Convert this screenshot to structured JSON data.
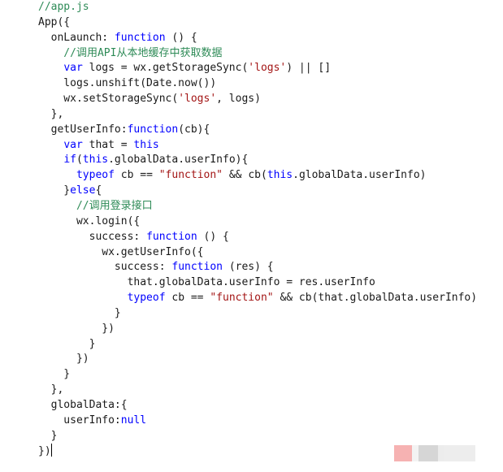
{
  "editor": {
    "lines": [
      [
        {
          "t": "//app.js",
          "c": "comment"
        }
      ],
      [
        {
          "t": "App({",
          "c": "plain"
        }
      ],
      [
        {
          "t": "  onLaunch: ",
          "c": "plain"
        },
        {
          "t": "function",
          "c": "keyword"
        },
        {
          "t": " () {",
          "c": "plain"
        }
      ],
      [
        {
          "t": "    //调用API从本地缓存中获取数据",
          "c": "comment"
        }
      ],
      [
        {
          "t": "    ",
          "c": "plain"
        },
        {
          "t": "var",
          "c": "keyword"
        },
        {
          "t": " logs = wx.getStorageSync(",
          "c": "plain"
        },
        {
          "t": "'logs'",
          "c": "string"
        },
        {
          "t": ") || []",
          "c": "plain"
        }
      ],
      [
        {
          "t": "    logs.unshift(Date.now())",
          "c": "plain"
        }
      ],
      [
        {
          "t": "    wx.setStorageSync(",
          "c": "plain"
        },
        {
          "t": "'logs'",
          "c": "string"
        },
        {
          "t": ", logs)",
          "c": "plain"
        }
      ],
      [
        {
          "t": "  },",
          "c": "plain"
        }
      ],
      [
        {
          "t": "  getUserInfo:",
          "c": "plain"
        },
        {
          "t": "function",
          "c": "keyword"
        },
        {
          "t": "(cb){",
          "c": "plain"
        }
      ],
      [
        {
          "t": "    ",
          "c": "plain"
        },
        {
          "t": "var",
          "c": "keyword"
        },
        {
          "t": " that = ",
          "c": "plain"
        },
        {
          "t": "this",
          "c": "keyword"
        }
      ],
      [
        {
          "t": "    ",
          "c": "plain"
        },
        {
          "t": "if",
          "c": "keyword"
        },
        {
          "t": "(",
          "c": "plain"
        },
        {
          "t": "this",
          "c": "keyword"
        },
        {
          "t": ".globalData.userInfo){",
          "c": "plain"
        }
      ],
      [
        {
          "t": "      ",
          "c": "plain"
        },
        {
          "t": "typeof",
          "c": "keyword"
        },
        {
          "t": " cb == ",
          "c": "plain"
        },
        {
          "t": "\"function\"",
          "c": "string"
        },
        {
          "t": " && cb(",
          "c": "plain"
        },
        {
          "t": "this",
          "c": "keyword"
        },
        {
          "t": ".globalData.userInfo)",
          "c": "plain"
        }
      ],
      [
        {
          "t": "    }",
          "c": "plain"
        },
        {
          "t": "else",
          "c": "keyword"
        },
        {
          "t": "{",
          "c": "plain"
        }
      ],
      [
        {
          "t": "      //调用登录接口",
          "c": "comment"
        }
      ],
      [
        {
          "t": "      wx.login({",
          "c": "plain"
        }
      ],
      [
        {
          "t": "        success: ",
          "c": "plain"
        },
        {
          "t": "function",
          "c": "keyword"
        },
        {
          "t": " () {",
          "c": "plain"
        }
      ],
      [
        {
          "t": "          wx.getUserInfo({",
          "c": "plain"
        }
      ],
      [
        {
          "t": "            success: ",
          "c": "plain"
        },
        {
          "t": "function",
          "c": "keyword"
        },
        {
          "t": " (res) {",
          "c": "plain"
        }
      ],
      [
        {
          "t": "              that.globalData.userInfo = res.userInfo",
          "c": "plain"
        }
      ],
      [
        {
          "t": "              ",
          "c": "plain"
        },
        {
          "t": "typeof",
          "c": "keyword"
        },
        {
          "t": " cb == ",
          "c": "plain"
        },
        {
          "t": "\"function\"",
          "c": "string"
        },
        {
          "t": " && cb(that.globalData.userInfo)",
          "c": "plain"
        }
      ],
      [
        {
          "t": "            }",
          "c": "plain"
        }
      ],
      [
        {
          "t": "          })",
          "c": "plain"
        }
      ],
      [
        {
          "t": "        }",
          "c": "plain"
        }
      ],
      [
        {
          "t": "      })",
          "c": "plain"
        }
      ],
      [
        {
          "t": "    }",
          "c": "plain"
        }
      ],
      [
        {
          "t": "  },",
          "c": "plain"
        }
      ],
      [
        {
          "t": "  globalData:{",
          "c": "plain"
        }
      ],
      [
        {
          "t": "    userInfo:",
          "c": "plain"
        },
        {
          "t": "null",
          "c": "keyword"
        }
      ],
      [
        {
          "t": "  }",
          "c": "plain"
        }
      ],
      [
        {
          "t": "})",
          "c": "plain"
        }
      ]
    ]
  },
  "colors": {
    "comment": "#2e8b57",
    "keyword": "#0000ff",
    "string": "#a31515",
    "plain": "#1a1a1a"
  }
}
